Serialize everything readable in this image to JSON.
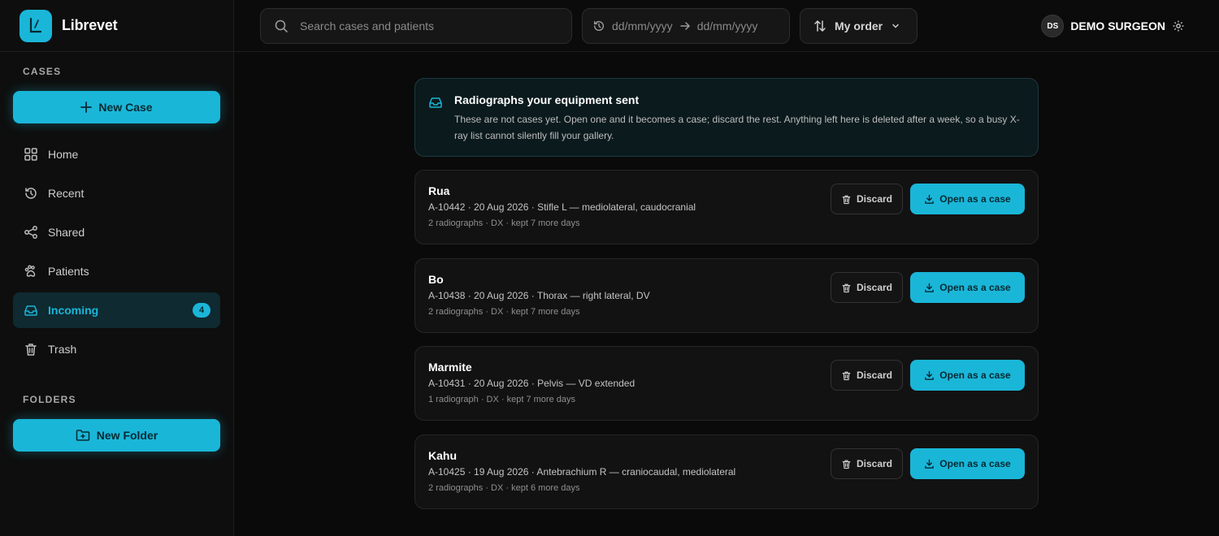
{
  "app": {
    "name": "Librevet"
  },
  "sidebar": {
    "cases_label": "CASES",
    "new_case_label": "New Case",
    "items": [
      {
        "label": "Home",
        "icon": "grid-icon"
      },
      {
        "label": "Recent",
        "icon": "history-icon"
      },
      {
        "label": "Shared",
        "icon": "share-icon"
      },
      {
        "label": "Patients",
        "icon": "paw-icon"
      },
      {
        "label": "Incoming",
        "icon": "inbox-icon",
        "badge": "4",
        "active": true
      },
      {
        "label": "Trash",
        "icon": "trash-icon"
      }
    ],
    "folders_label": "FOLDERS",
    "new_folder_label": "New Folder"
  },
  "topbar": {
    "search_placeholder": "Search cases and patients",
    "date_from": "dd/mm/yyyy",
    "date_to": "dd/mm/yyyy",
    "sort_label": "My order",
    "user_initials": "DS",
    "user_name": "DEMO SURGEON"
  },
  "notice": {
    "title": "Radiographs your equipment sent",
    "body": "These are not cases yet. Open one and it becomes a case; discard the rest. Anything left here is deleted after a week, so a busy X-ray list cannot silently fill your gallery."
  },
  "actions": {
    "discard_label": "Discard",
    "open_label": "Open as a case"
  },
  "incoming": [
    {
      "name": "Rua",
      "meta": "A-10442 · 20 Aug 2026 · Stifle L — mediolateral, caudocranial",
      "sub": "2 radiographs · DX · kept 7 more days"
    },
    {
      "name": "Bo",
      "meta": "A-10438 · 20 Aug 2026 · Thorax — right lateral, DV",
      "sub": "2 radiographs · DX · kept 7 more days"
    },
    {
      "name": "Marmite",
      "meta": "A-10431 · 20 Aug 2026 · Pelvis — VD extended",
      "sub": "1 radiograph · DX · kept 7 more days"
    },
    {
      "name": "Kahu",
      "meta": "A-10425 · 19 Aug 2026 · Antebrachium R — craniocaudal, mediolateral",
      "sub": "2 radiographs · DX · kept 6 more days"
    }
  ],
  "colors": {
    "accent": "#1ab6d8",
    "background": "#0a0a0a"
  }
}
